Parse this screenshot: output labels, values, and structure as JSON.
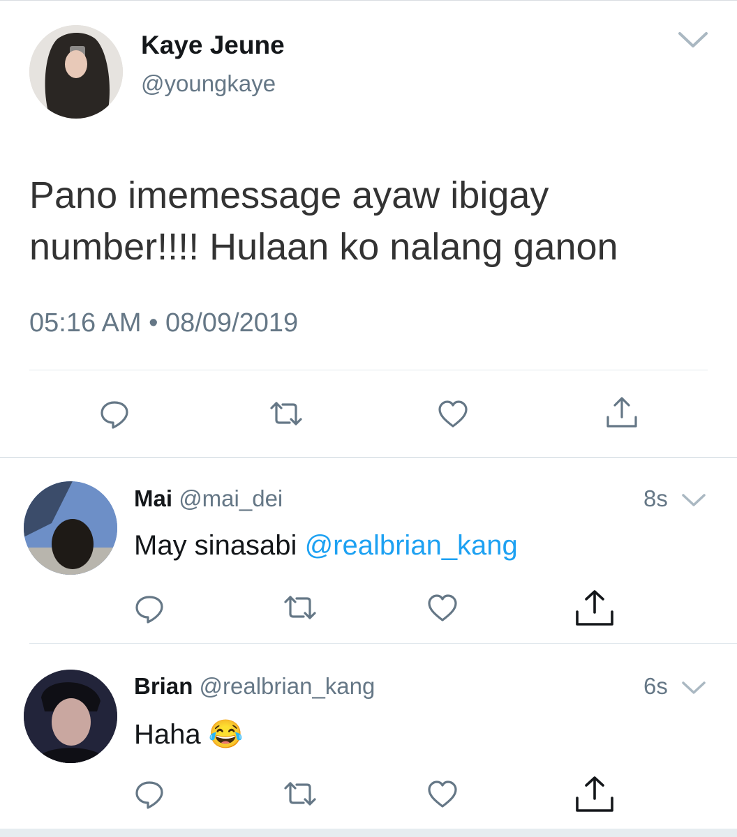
{
  "main_tweet": {
    "author": {
      "display_name": "Kaye Jeune",
      "handle": "@youngkaye",
      "avatar_icon": "user-photo-avatar"
    },
    "text_line1": "Pano imemessage ayaw ibigay",
    "text_line2": "number!!!! Hulaan ko nalang ganon",
    "timestamp": "05:16 AM • 08/09/2019",
    "actions": [
      "reply-icon",
      "retweet-icon",
      "like-icon",
      "share-icon"
    ]
  },
  "replies": [
    {
      "display_name": "Mai",
      "handle": "@mai_dei",
      "age": "8s",
      "text": "May sinasabi ",
      "mention": "@realbrian_kang"
    },
    {
      "display_name": "Brian",
      "handle": "@realbrian_kang",
      "age": "6s",
      "text": "Haha ",
      "emoji": "😂"
    }
  ],
  "colors": {
    "text": "#14171a",
    "muted": "#657786",
    "link": "#1da1f2",
    "divider": "#e1e8ed"
  }
}
